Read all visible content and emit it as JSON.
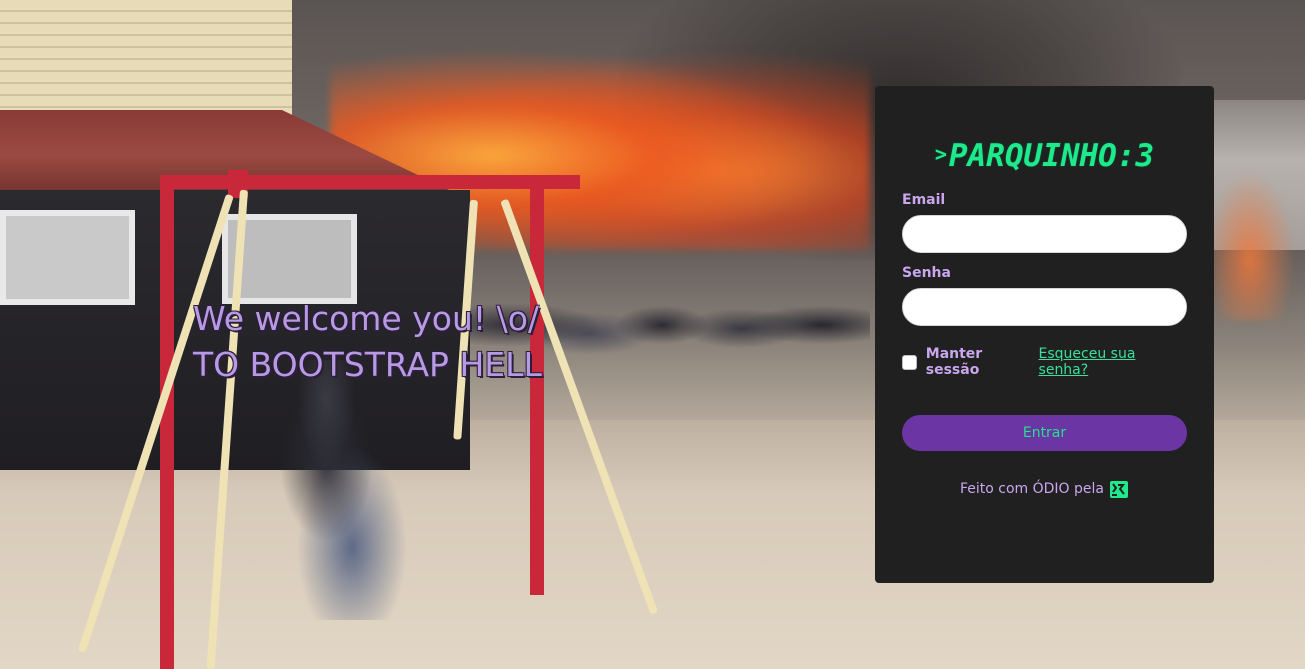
{
  "welcome": {
    "line1": "We welcome you! \\o/",
    "line2": "TO BOOTSTRAP HELL"
  },
  "login": {
    "logo_text": "PARQUINHO:3",
    "logo_prompt": ">",
    "email_label": "Email",
    "email_value": "",
    "password_label": "Senha",
    "password_value": "",
    "remember_label": "Manter sessão",
    "remember_checked": false,
    "forgot_link": "Esqueceu sua senha?",
    "submit_label": "Entrar",
    "footer_text": "Feito com ÓDIO pela",
    "footer_icon": "team-logo-icon"
  },
  "colors": {
    "card_background": "#202020",
    "accent_green": "#1eea8c",
    "label_purple": "#c9a6ee",
    "button_purple": "#6b35a4",
    "welcome_text": "#b899e3"
  }
}
